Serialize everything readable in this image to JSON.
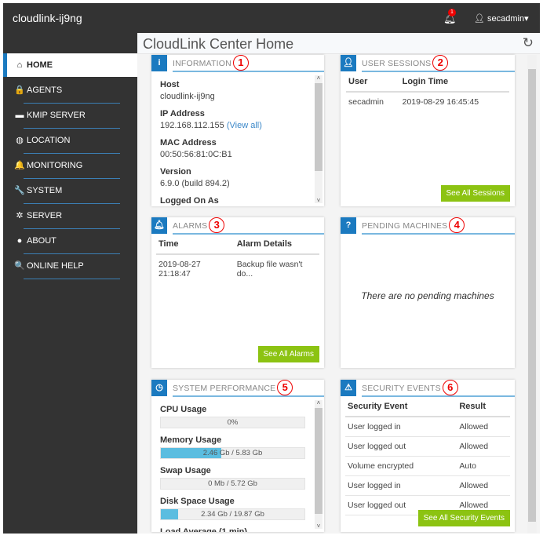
{
  "app": {
    "brand": "cloudlink-ij9ng",
    "notification_count": "1",
    "user": "secadmin",
    "user_caret": "▾"
  },
  "page": {
    "title": "CloudLink Center Home"
  },
  "sidebar": {
    "items": [
      {
        "label": "HOME",
        "icon": "⌂"
      },
      {
        "label": "AGENTS",
        "icon": "🔒"
      },
      {
        "label": "KMIP SERVER",
        "icon": "▬"
      },
      {
        "label": "LOCATION",
        "icon": "◍"
      },
      {
        "label": "MONITORING",
        "icon": "🔔"
      },
      {
        "label": "SYSTEM",
        "icon": "🔧"
      },
      {
        "label": "SERVER",
        "icon": "✲"
      },
      {
        "label": "ABOUT",
        "icon": "●"
      },
      {
        "label": "ONLINE HELP",
        "icon": "🔍"
      }
    ]
  },
  "panels": {
    "information": {
      "title": "INFORMATION",
      "marker": "1",
      "items": [
        {
          "label": "Host",
          "value": "cloudlink-ij9ng"
        },
        {
          "label": "IP Address",
          "value": "192.168.112.155",
          "link": "(View all)"
        },
        {
          "label": "MAC Address",
          "value": "00:50:56:81:0C:B1"
        },
        {
          "label": "Version",
          "value": "6.9.0 (build 894.2)"
        },
        {
          "label": "Logged On As",
          "value": ""
        }
      ]
    },
    "user_sessions": {
      "title": "USER SESSIONS",
      "marker": "2",
      "headers": [
        "User",
        "Login Time"
      ],
      "rows": [
        [
          "secadmin",
          "2019-08-29 16:45:45"
        ]
      ],
      "button": "See All Sessions"
    },
    "alarms": {
      "title": "ALARMS",
      "marker": "3",
      "headers": [
        "Time",
        "Alarm Details"
      ],
      "rows": [
        [
          "2019-08-27 21:18:47",
          "Backup file wasn't do..."
        ]
      ],
      "button": "See All Alarms"
    },
    "pending": {
      "title": "PENDING MACHINES",
      "marker": "4",
      "empty": "There are no pending machines"
    },
    "performance": {
      "title": "SYSTEM PERFORMANCE",
      "marker": "5",
      "metrics": [
        {
          "label": "CPU Usage",
          "text": "0%",
          "percent": 0
        },
        {
          "label": "Memory Usage",
          "text": "2.46 Gb / 5.83 Gb",
          "percent": 42
        },
        {
          "label": "Swap Usage",
          "text": "0 Mb / 5.72 Gb",
          "percent": 0
        },
        {
          "label": "Disk Space Usage",
          "text": "2.34 Gb / 19.87 Gb",
          "percent": 12
        },
        {
          "label": "Load Average (1 min)",
          "text": "",
          "percent": 0
        }
      ]
    },
    "security": {
      "title": "SECURITY EVENTS",
      "marker": "6",
      "headers": [
        "Security Event",
        "Result"
      ],
      "rows": [
        [
          "User logged in",
          "Allowed"
        ],
        [
          "User logged out",
          "Allowed"
        ],
        [
          "Volume encrypted",
          "Auto"
        ],
        [
          "User logged in",
          "Allowed"
        ],
        [
          "User logged out",
          "Allowed"
        ]
      ],
      "button": "See All Security Events"
    }
  }
}
